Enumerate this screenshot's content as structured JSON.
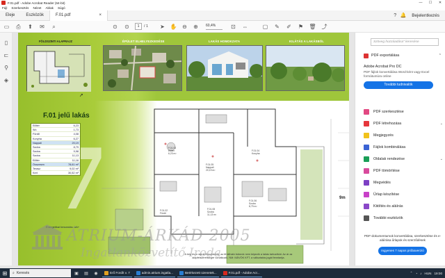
{
  "window": {
    "title": "F.01.pdf - Adobe Acrobat Reader (64-bit)",
    "controls": [
      "—",
      "☐",
      "✕"
    ]
  },
  "menubar": [
    "Fájl",
    "Szerkesztés",
    "Nézet",
    "Ablak",
    "Súgó"
  ],
  "tabs": {
    "home": "Eleje",
    "tools": "Eszközök",
    "document": "F.01.pdf",
    "document_close": "×",
    "signin": "Bejelentkezés"
  },
  "toolbar": {
    "page_current": "1",
    "page_total": "/ 1",
    "zoom": "60,4%"
  },
  "document": {
    "site_caption": "FÖLDSZINTI ALAPRAJZ",
    "photo_captions": [
      "ÉPÜLET ELHELYEZKEDÉSE",
      "LAKÁS HOMOKZATA",
      "KILÁTÁS A LAKÁSBÓL"
    ],
    "flat_title": "F.01 jelű lakás",
    "rooms": [
      {
        "name": "Előtér",
        "value": "6,23"
      },
      {
        "name": "Wc",
        "value": "1,73"
      },
      {
        "name": "Fürdő",
        "value": "4,08"
      },
      {
        "name": "Konyha",
        "value": "6,27"
      },
      {
        "name": "Nappali",
        "value": "20,19"
      },
      {
        "name": "Szoba",
        "value": "8,79"
      },
      {
        "name": "Szoba",
        "value": "9,98"
      },
      {
        "name": "Szoba",
        "value": "11,13"
      },
      {
        "name": "Előtér",
        "value": "11,16"
      },
      {
        "name": "Összesen",
        "value": "78,61 m²"
      },
      {
        "name": "Terasz",
        "value": "9,02 m²"
      },
      {
        "name": "Kert",
        "value": "30,52 m²"
      }
    ],
    "energy_text": "Energetikai besorolás: AA+",
    "scale_text": "9m",
    "plan_labels": [
      "F.01.03\nElőtér\n6,23 m²",
      "F.01.05\nNappali\n20,19 m²",
      "F.01.06\nSzoba\n8,79 m²",
      "F.01.08\nSzoba\n11,13 m²",
      "F.01.04\nKonyha",
      "F.01.02\nFürdő"
    ],
    "footnote": "A kép és a rajzok illusztrációk, az itt látható bútorok nem képezik a lakás tartozékát. Az ár az alapfelszereltségre vonatkozik. NM: MÁVÖK KFT. a változtatás jogát fenntartja.",
    "watermark_line1": "ÁTRIUM-ÁRKÁD 2005",
    "watermark_line2": "Ingatlanközvetítő Iroda"
  },
  "rightpane": {
    "search_placeholder": "Szöveg hozzáadása” keresése",
    "export_label": "PDF exportálása",
    "promo_title": "Adobe Acrobat Pro DC",
    "promo_desc": "PDF fájlok konvertálása Word-ként vagy Excel formátumúra online",
    "promo_button": "További tudnivalók",
    "tools": [
      {
        "label": "PDF szerkesztése",
        "color": "#e24882",
        "chev": ""
      },
      {
        "label": "PDF létrehozása",
        "color": "#e6363c",
        "chev": "⌄"
      },
      {
        "label": "Megjegyzés",
        "color": "#f1c21b",
        "chev": ""
      },
      {
        "label": "Fájlok kombinálása",
        "color": "#3b63d4",
        "chev": ""
      },
      {
        "label": "Oldalak rendezése",
        "color": "#1a9e57",
        "chev": "⌄"
      },
      {
        "label": "PDF tömörítése",
        "color": "#d84a9c",
        "chev": ""
      },
      {
        "label": "Megvédés",
        "color": "#7d3fc4",
        "chev": ""
      },
      {
        "label": "Űrlap készítése",
        "color": "#c840c8",
        "chev": ""
      },
      {
        "label": "Kitöltés és aláírás",
        "color": "#8a48c8",
        "chev": ""
      },
      {
        "label": "További eszközök",
        "color": "#555555",
        "chev": ""
      }
    ],
    "promo2_text": "PDF-dokumentumok konvertálása, szerkesztése és e-aláírása űrlapok és szerződések",
    "promo2_button": "Ingyenes 7 napos próbaverzió"
  },
  "taskbar": {
    "search": "Keresés",
    "tasks": [
      {
        "label": "Erő Fordít v. 7",
        "color": "#e0a021"
      },
      {
        "label": "admin.atrium.ingatla...",
        "color": "#2a7dd1"
      },
      {
        "label": "Beérkezett üzenetek...",
        "color": "#2a7dd1"
      },
      {
        "label": "F.01.pdf - Adobe Acr...",
        "color": "#d7281e"
      }
    ],
    "time": "19:00",
    "lang": "HUN"
  }
}
